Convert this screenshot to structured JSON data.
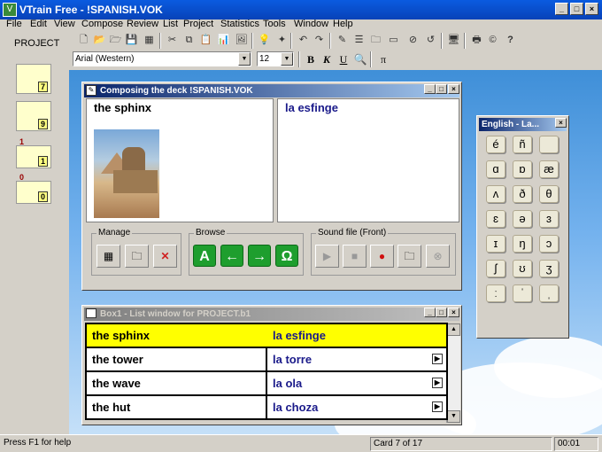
{
  "app": {
    "title": "VTrain Free - !SPANISH.VOK"
  },
  "menu": [
    "File",
    "Edit",
    "View",
    "Compose",
    "Review",
    "List",
    "Project",
    "Statistics",
    "Tools",
    "Window",
    "Help"
  ],
  "project_label": "PROJECT",
  "boxes": [
    {
      "label": "7",
      "count": ""
    },
    {
      "label": "9",
      "count": ""
    },
    {
      "label": "1",
      "count": "1"
    },
    {
      "label": "0",
      "count": "0"
    }
  ],
  "format": {
    "font": "Arial (Western)",
    "size": "12",
    "bold": "B",
    "italic": "K",
    "underline": "U"
  },
  "compose": {
    "title": "Composing the deck !SPANISH.VOK",
    "front_word": "the sphinx",
    "back_word": "la esfinge",
    "groups": {
      "manage": "Manage",
      "browse": "Browse",
      "sound": "Sound file (Front)"
    },
    "browse_buttons": [
      "A",
      "←",
      "→",
      "Ω"
    ]
  },
  "keyboard": {
    "title": "English - La...",
    "keys": [
      "é",
      "ñ",
      "",
      "ɑ",
      "ɒ",
      "æ",
      "ʌ",
      "ð",
      "θ",
      "ɛ",
      "ə",
      "ɜ",
      "ɪ",
      "ŋ",
      "ɔ",
      "ʃ",
      "ʊ",
      "ʒ",
      "ː",
      "ˈ",
      "ˌ"
    ]
  },
  "list": {
    "title": "Box1 - List window for PROJECT.b1",
    "rows": [
      {
        "front": "the sphinx",
        "back": "la esfinge",
        "selected": true
      },
      {
        "front": "the tower",
        "back": "la torre",
        "selected": false
      },
      {
        "front": "the wave",
        "back": "la ola",
        "selected": false
      },
      {
        "front": "the hut",
        "back": "la choza",
        "selected": false
      }
    ]
  },
  "status": {
    "help": "Press F1 for help",
    "card": "Card 7 of 17",
    "time": "00:01"
  }
}
